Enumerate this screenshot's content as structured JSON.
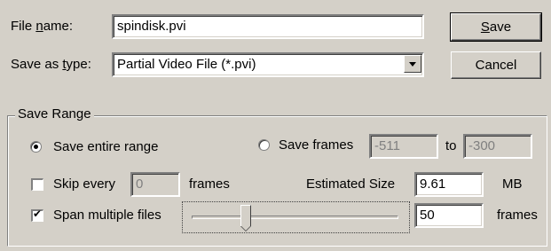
{
  "file": {
    "name_label": "File name:",
    "name_value": "spindisk.pvi",
    "type_label": "Save as type:",
    "type_value": "Partial Video File (*.pvi)"
  },
  "buttons": {
    "save": "Save",
    "cancel": "Cancel"
  },
  "range": {
    "title": "Save Range",
    "entire_label": "Save entire range",
    "frames_label": "Save frames",
    "from_value": "-511",
    "to_label": "to",
    "to_value": "-300",
    "entire_selected": true,
    "frames_selected": false
  },
  "skip": {
    "label": "Skip every",
    "value": "0",
    "unit": "frames",
    "checked": false
  },
  "estimate": {
    "label": "Estimated Size",
    "value": "9.61",
    "unit": "MB"
  },
  "span": {
    "label": "Span multiple files",
    "checked": true,
    "slider_fraction": 0.25,
    "value": "50",
    "unit": "frames"
  }
}
